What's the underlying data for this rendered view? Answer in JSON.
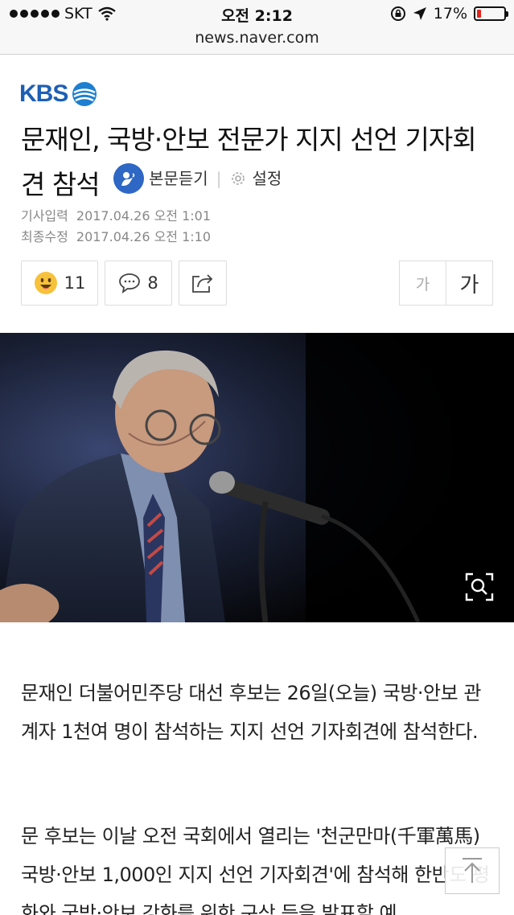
{
  "status_bar": {
    "carrier": "SKT",
    "time": "오전 2:12",
    "battery_percent": "17%",
    "battery_level": 0.17
  },
  "browser": {
    "url": "news.naver.com"
  },
  "article": {
    "press": "KBS",
    "title": "문재인, 국방·안보 전문가 지지 선언 기자회견 참석",
    "tts_label": "본문듣기",
    "settings_label": "설정",
    "input_label": "기사입력",
    "input_time": "2017.04.26 오전 1:01",
    "modified_label": "최종수정",
    "modified_time": "2017.04.26 오전 1:10",
    "like_count": "11",
    "comment_count": "8",
    "font_small": "가",
    "font_large": "가",
    "paragraph_1": "문재인 더불어민주당 대선 후보는 26일(오늘) 국방·안보 관계자 1천여 명이 참석하는 지지 선언 기자회견에 참석한다.",
    "paragraph_2": "문 후보는 이날 오전 국회에서 열리는 '천군만마(千軍萬馬) 국방·안보 1,000인 지지 선언 기자회견'에 참석해 한반도 평화와 국방·안보 강화를 위한 구상 등을 발표할 예"
  },
  "icons": {
    "signal": "signal-dots-icon",
    "wifi": "wifi-icon",
    "lock": "rotation-lock-icon",
    "location": "location-arrow-icon",
    "battery": "battery-icon",
    "tts": "tts-speaker-icon",
    "settings": "gear-icon",
    "like": "smile-emoji-icon",
    "comment": "comment-bubble-icon",
    "share": "share-icon",
    "zoom": "zoom-magnifier-icon",
    "top": "scroll-top-arrow-icon"
  },
  "colors": {
    "kbs_blue": "#1d5fb4",
    "tts_blue": "#2e67c4",
    "battery_red": "#e0251f"
  }
}
